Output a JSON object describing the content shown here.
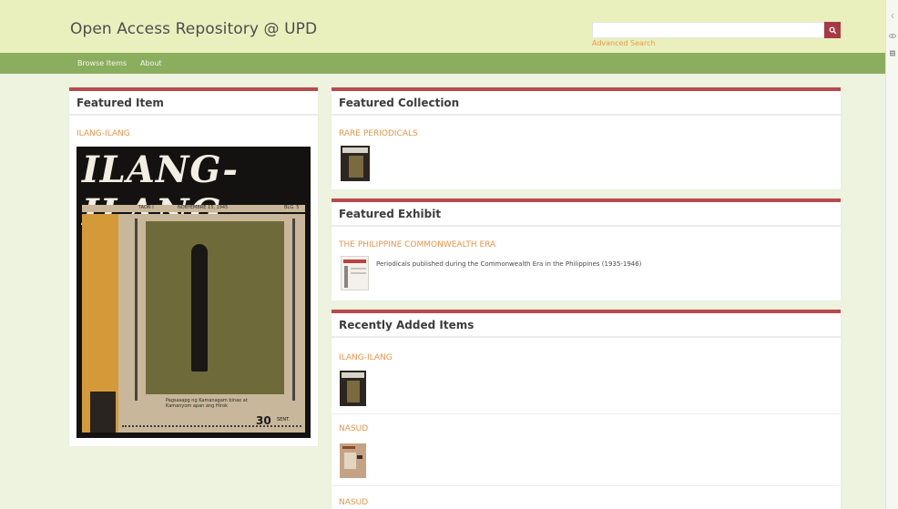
{
  "header": {
    "site_title": "Open Access Repository @ UPD",
    "search_placeholder": "",
    "advanced_search_label": "Advanced Search"
  },
  "nav": {
    "items": [
      {
        "label": "Browse Items"
      },
      {
        "label": "About"
      }
    ]
  },
  "featured_item": {
    "heading": "Featured Item",
    "title": "ILANG-ILANG",
    "cover_title": "ILANG-ILANG",
    "cover_issue_left": "TAON I",
    "cover_issue_date": "NOBYEMBRE 15, 1945",
    "cover_issue_right": "BLG. 5",
    "cover_caption": "Pagsasapg ng Kamanagam binao at Kamanyom apan ang Hirok",
    "cover_price": "30",
    "cover_price_unit": "SENT."
  },
  "featured_collection": {
    "heading": "Featured Collection",
    "title": "RARE PERIODICALS"
  },
  "featured_exhibit": {
    "heading": "Featured Exhibit",
    "title": "THE PHILIPPINE COMMONWEALTH ERA",
    "description": "Periodicals published during the Commonwealth Era in the Philippines (1935-1946)"
  },
  "recent": {
    "heading": "Recently Added Items",
    "items": [
      {
        "title": "ILANG-ILANG"
      },
      {
        "title": "NASUD"
      },
      {
        "title": "NASUD"
      }
    ]
  },
  "colors": {
    "header_bg": "#eaf0bd",
    "nav_bg": "#8aae5e",
    "accent": "#b84a4f",
    "link": "#e4964a"
  }
}
